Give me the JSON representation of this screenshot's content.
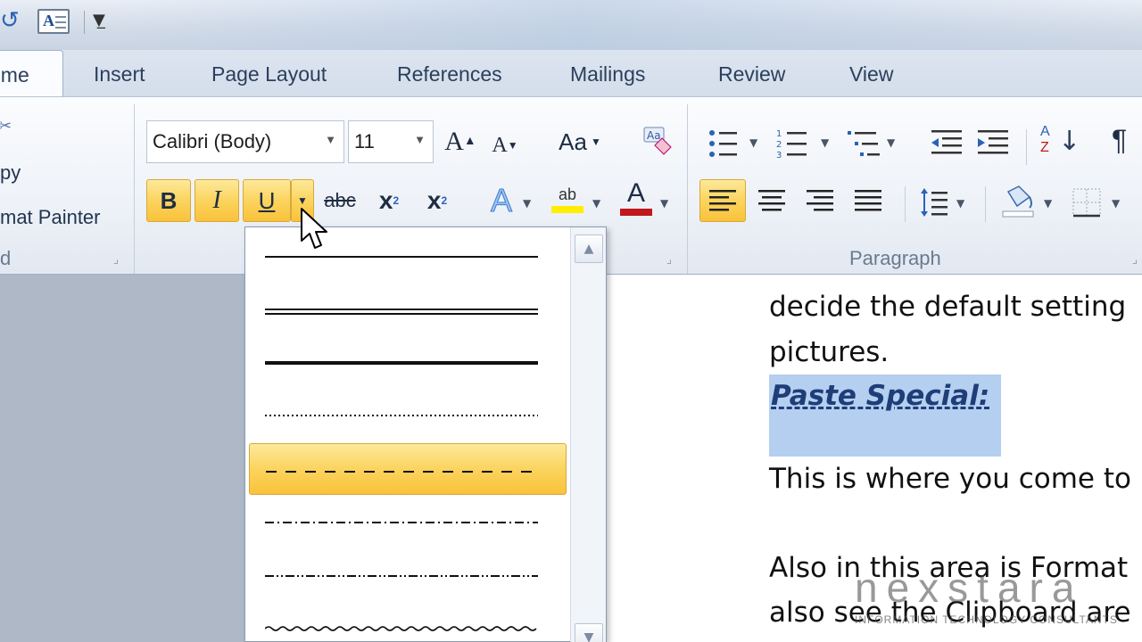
{
  "quick_access": {
    "redo_icon": "redo-icon",
    "doc_icon": "document-icon",
    "customize_icon": "customize-dropdown-icon",
    "doc_letter": "A"
  },
  "tabs": [
    {
      "label": "Home",
      "visible": "ome",
      "active": true
    },
    {
      "label": "Insert"
    },
    {
      "label": "Page Layout"
    },
    {
      "label": "References"
    },
    {
      "label": "Mailings"
    },
    {
      "label": "Review"
    },
    {
      "label": "View"
    }
  ],
  "clipboard": {
    "copy": "py",
    "format_painter": "mat Painter",
    "group_label": "d"
  },
  "font": {
    "name": "Calibri (Body)",
    "size": "11",
    "grow": "A",
    "shrink": "A",
    "change_case": "Aa",
    "bold": "B",
    "italic": "I",
    "underline": "U",
    "strike": "abc",
    "subscript": "x",
    "superscript": "x",
    "sub_mark": "2",
    "sup_mark": "2",
    "highlight": "ab",
    "font_color": "A",
    "text_effects": "A"
  },
  "paragraph": {
    "group_label": "Paragraph",
    "pilcrow": "¶",
    "sort_a": "A",
    "sort_z": "Z"
  },
  "document": {
    "lines": [
      "decide the default setting",
      "pictures.",
      "This is where you come to",
      "Also in this area is Format",
      "also see the Clipboard are"
    ],
    "heading": "Paste Special:"
  },
  "underline_gallery": {
    "styles": [
      "single",
      "double",
      "thick",
      "dotted",
      "dashed",
      "dot-dash",
      "dot-dot-dash",
      "wave"
    ],
    "hovered": "dashed"
  },
  "watermark": {
    "brand": "nexstara",
    "tagline": "INFORMATION TECHNOLOGY CONSULTANTS"
  },
  "colors": {
    "selected_gold": "#f9c23b",
    "font_color_red": "#c0181b",
    "highlight_yellow": "#ffee00",
    "heading_blue": "#1f3d77",
    "selection_blue": "#b4cff0"
  }
}
